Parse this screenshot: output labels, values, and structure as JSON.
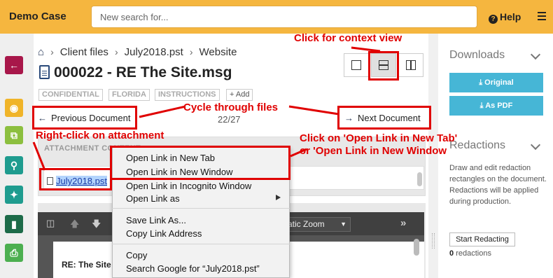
{
  "topbar": {
    "app_title": "Demo Case",
    "search_placeholder": "New search for...",
    "help_label": "Help"
  },
  "rail": {
    "buttons": [
      {
        "icon": "back-arrow-icon",
        "color": "#a8174a"
      },
      {
        "icon": "eye-icon",
        "color": "#f0b429"
      },
      {
        "icon": "copy-icon",
        "color": "#8cbf3f"
      },
      {
        "icon": "search-icon",
        "color": "#1f9c8f"
      },
      {
        "icon": "puzzle-icon",
        "color": "#1f9c8f"
      },
      {
        "icon": "bookmark-icon",
        "color": "#1d6b49"
      },
      {
        "icon": "print-icon",
        "color": "#4caf50"
      }
    ]
  },
  "breadcrumb": {
    "home_icon": "home-icon",
    "items": [
      "Client files",
      "July2018.pst",
      "Website"
    ]
  },
  "document": {
    "title": "000022 - RE The Site.msg",
    "icon": "file-text-icon"
  },
  "view_modes": [
    "single-pane",
    "split-horizontal",
    "split-vertical"
  ],
  "tags": [
    "CONFIDENTIAL",
    "FLORIDA",
    "INSTRUCTIONS"
  ],
  "add_tag_label": "+ Add",
  "navigation": {
    "previous": "Previous Document",
    "next": "Next Document",
    "counter": "22/27"
  },
  "attachments": {
    "header": "ATTACHMENT CONTENT",
    "file": "July2018.pst"
  },
  "viewer": {
    "zoom": "matic Zoom",
    "page_heading": "RE: The Site"
  },
  "sidebar": {
    "downloads_title": "Downloads",
    "original_btn": "Original",
    "pdf_btn": "As PDF",
    "redactions_title": "Redactions",
    "redactions_desc": "Draw and edit redaction rectangles on the document. Redactions will be applied during production.",
    "start_btn": "Start Redacting",
    "count_num": "0",
    "count_label": "redactions"
  },
  "context_menu": {
    "items": [
      "Open Link in New Tab",
      "Open Link in New Window",
      "Open Link in Incognito Window",
      "Open Link as",
      "Save Link As...",
      "Copy Link Address",
      "Copy",
      "Search Google for “July2018.pst”"
    ]
  },
  "annotations": {
    "context_view": "Click for context view",
    "cycle": "Cycle through files",
    "right_click": "Right-click on attachment",
    "open_link_1": "Click on 'Open Link in New Tab'",
    "open_link_2": "or 'Open Link in New Window"
  },
  "colors": {
    "topbar": "#f5b63f",
    "accent": "#46b6d6",
    "annotation": "#e00000"
  }
}
